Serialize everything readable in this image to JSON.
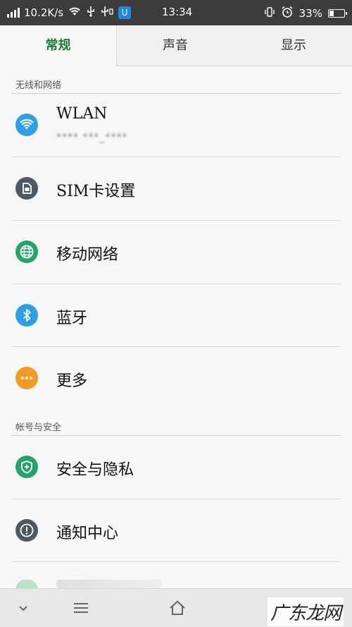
{
  "status_bar": {
    "speed": "10.2K/s",
    "time": "13:34",
    "battery": "33%",
    "battery_level": 0.33,
    "badge": "U"
  },
  "tabs": [
    {
      "label": "常规",
      "active": true
    },
    {
      "label": "声音",
      "active": false
    },
    {
      "label": "显示",
      "active": false
    }
  ],
  "sections": [
    {
      "label": "无线和网络"
    },
    {
      "label": "帐号与安全"
    }
  ],
  "items": [
    {
      "title": "WLAN",
      "subtitle": "**** ***_****",
      "icon": "wifi-icon",
      "color": "#2f9ee6"
    },
    {
      "title": "SIM卡设置",
      "icon": "sim-card-icon",
      "color": "#4d5a63"
    },
    {
      "title": "移动网络",
      "icon": "globe-icon",
      "color": "#25a36a"
    },
    {
      "title": "蓝牙",
      "icon": "bluetooth-icon",
      "color": "#2f9ee6"
    },
    {
      "title": "更多",
      "icon": "more-icon",
      "color": "#f29a23"
    },
    {
      "title": "安全与隐私",
      "icon": "shield-icon",
      "color": "#25a36a"
    },
    {
      "title": "通知中心",
      "icon": "alert-icon",
      "color": "#4d5a63"
    }
  ],
  "bottom_nav": {
    "back_icon": "chevron-down-icon",
    "menu_icon": "menu-icon",
    "home_icon": "home-icon"
  },
  "watermark": "广东龙网"
}
